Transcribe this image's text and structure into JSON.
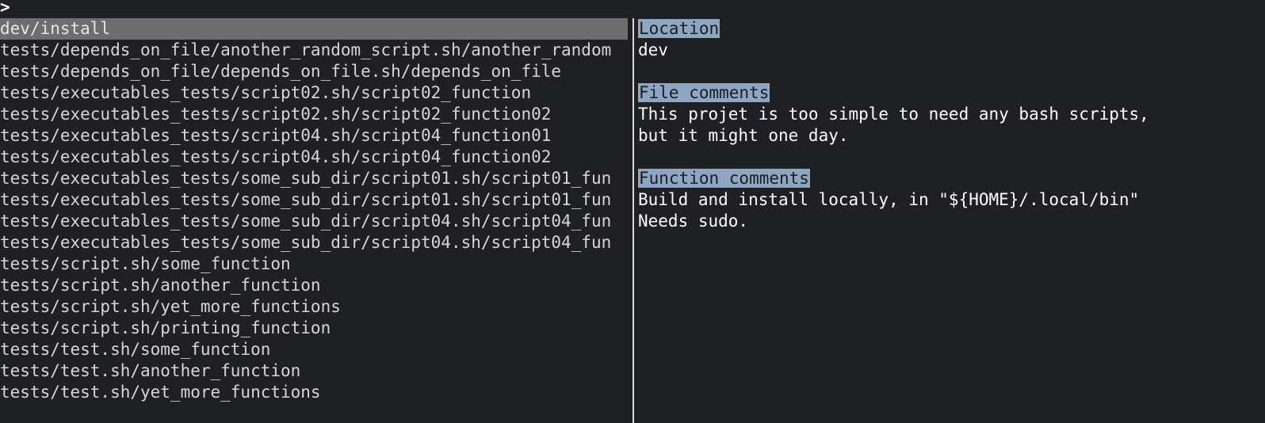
{
  "prompt": {
    "symbol": ">"
  },
  "list": {
    "items": [
      "dev/install",
      "tests/depends_on_file/another_random_script.sh/another_random",
      "tests/depends_on_file/depends_on_file.sh/depends_on_file",
      "tests/executables_tests/script02.sh/script02_function",
      "tests/executables_tests/script02.sh/script02_function02",
      "tests/executables_tests/script04.sh/script04_function01",
      "tests/executables_tests/script04.sh/script04_function02",
      "tests/executables_tests/some_sub_dir/script01.sh/script01_fun",
      "tests/executables_tests/some_sub_dir/script01.sh/script01_fun",
      "tests/executables_tests/some_sub_dir/script04.sh/script04_fun",
      "tests/executables_tests/some_sub_dir/script04.sh/script04_fun",
      "tests/script.sh/some_function",
      "tests/script.sh/another_function",
      "tests/script.sh/yet_more_functions",
      "tests/script.sh/printing_function",
      "tests/test.sh/some_function",
      "tests/test.sh/another_function",
      "tests/test.sh/yet_more_functions"
    ]
  },
  "preview": {
    "location_header": "Location",
    "location_value": "dev",
    "file_comments_header": "File comments",
    "file_comments_line1": "This projet is too simple to need any bash scripts,",
    "file_comments_line2": "but it might one day.",
    "function_comments_header": "Function comments",
    "function_comments_line1": "Build and install locally, in \"${HOME}/.local/bin\"",
    "function_comments_line2": "Needs sudo."
  },
  "colors": {
    "background": "#1f2024",
    "selected_row": "#6e6e6e",
    "header_highlight": "#8ea6c2"
  }
}
